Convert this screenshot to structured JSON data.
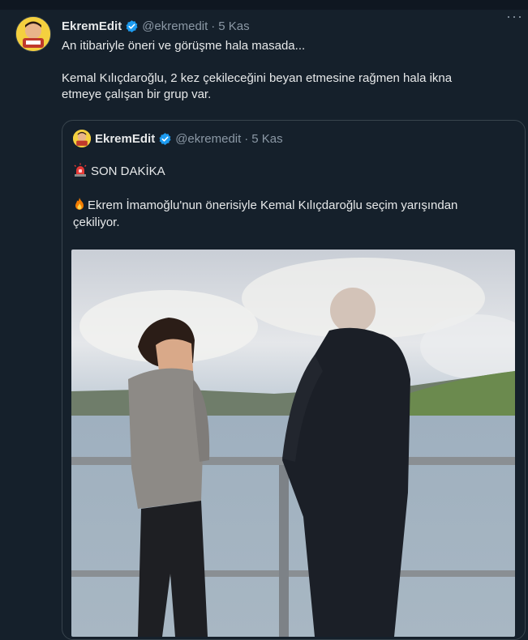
{
  "tweet": {
    "name": "EkremEdit",
    "handle": "@ekremedit",
    "separator": "·",
    "time": "5 Kas",
    "more_label": "···",
    "line1": "An itibariyle öneri ve görüşme hala masada...",
    "line2": "Kemal Kılıçdaroğlu,  2 kez çekileceğini beyan etmesine rağmen hala ikna",
    "line3": "etmeye çalışan bir grup var."
  },
  "quote": {
    "name": "EkremEdit",
    "handle": "@ekremedit",
    "separator": "·",
    "time": "5 Kas",
    "breaking_label": "SON DAKİKA",
    "body_line1": "Ekrem İmamoğlu'nun önerisiyle Kemal Kılıçdaroğlu seçim yarışından",
    "body_line2": "çekiliyor."
  },
  "colors": {
    "background": "#15202b",
    "border": "#38444d",
    "verified": "#1d9bf0",
    "secondary_text": "#8b98a5"
  },
  "icons": {
    "verified": "verified-badge-icon",
    "more": "more-options-icon",
    "siren": "siren-emoji-icon",
    "fire": "fire-emoji-icon"
  }
}
